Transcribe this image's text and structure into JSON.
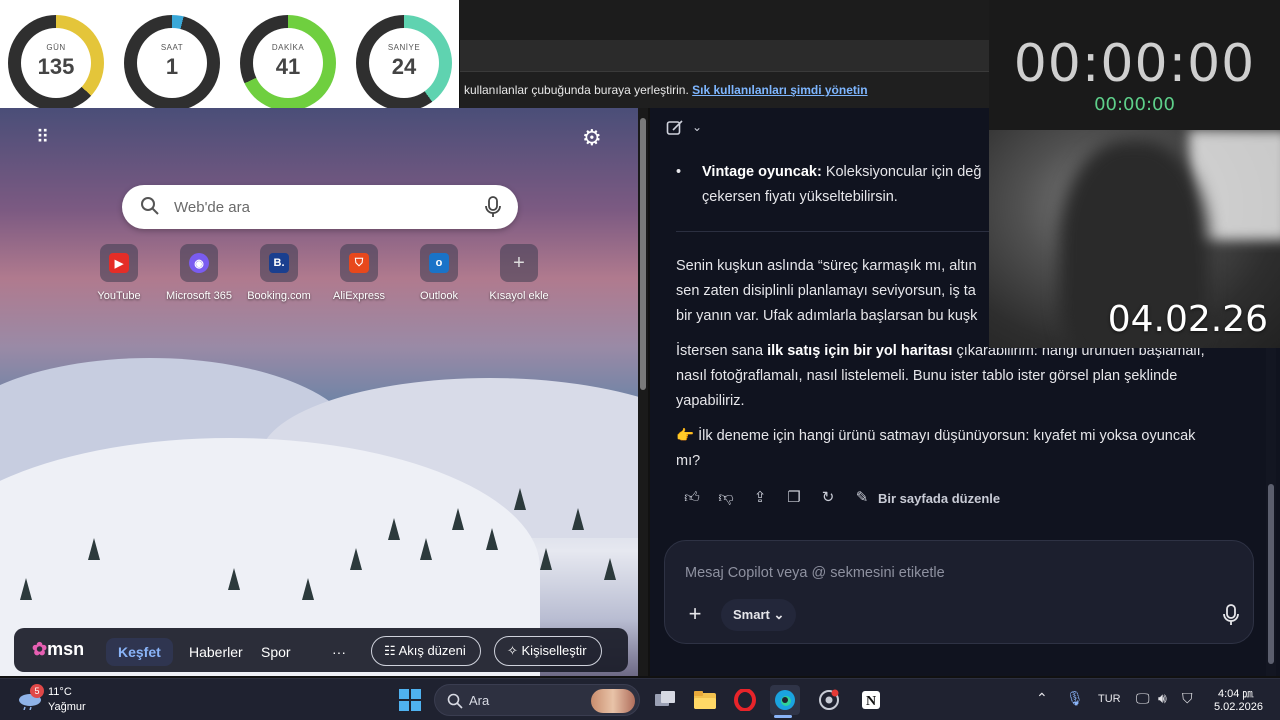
{
  "countdown": {
    "units": [
      {
        "label": "GÜN",
        "value": "135",
        "progress": 0.37,
        "color": "#e4c53a"
      },
      {
        "label": "SAAT",
        "value": "1",
        "progress": 0.04,
        "color": "#3aa8d8"
      },
      {
        "label": "DAKİKA",
        "value": "41",
        "progress": 0.68,
        "color": "#6fcf3f"
      },
      {
        "label": "SANİYE",
        "value": "24",
        "progress": 0.4,
        "color": "#5fd3b0"
      }
    ]
  },
  "stopwatch": {
    "main": "00:00:00",
    "sub": "00:00:00"
  },
  "webcam": {
    "date_overlay": "04.02.26"
  },
  "favorites_bar": {
    "text": "kullanılanlar çubuğunda buraya yerleştirin.",
    "link": "Sık kullanılanları şimdi yönetin"
  },
  "new_tab": {
    "search_placeholder": "Web'de ara",
    "quick_links": [
      {
        "label": "YouTube",
        "icon": "youtube-icon",
        "color": "#e52d27",
        "glyph": "▶"
      },
      {
        "label": "Microsoft 365",
        "icon": "microsoft-365-icon",
        "color": "#7a5cf0",
        "glyph": "◉"
      },
      {
        "label": "Booking.com",
        "icon": "booking-icon",
        "color": "#1a3f8f",
        "glyph": "B."
      },
      {
        "label": "AliExpress",
        "icon": "aliexpress-icon",
        "color": "#e8481c",
        "glyph": "⛉"
      },
      {
        "label": "Outlook",
        "icon": "outlook-icon",
        "color": "#1a73c8",
        "glyph": "o"
      },
      {
        "label": "Kısayol ekle",
        "icon": "add-shortcut-icon",
        "color": "transparent",
        "glyph": "+"
      }
    ],
    "msn": {
      "logo": "msn",
      "tabs": [
        "Keşfet",
        "Haberler",
        "Spor"
      ],
      "more": "···",
      "feed_layout": "Akış düzeni",
      "personalize": "Kişiselleştir"
    }
  },
  "copilot": {
    "bullet_label": "Vintage oyuncak:",
    "bullet_text": " Koleksiyoncular için değ",
    "bullet_text_2": "çekersen fiyatı yükseltebilirsin.",
    "para1_line1": "Senin kuşkun aslında “süreç karmaşık mı, altın",
    "para1_line2": "sen zaten disiplinli planlamayı seviyorsun, iş ta",
    "para1_line3": "bir yanın var. Ufak adımlarla başlarsan bu kuşk",
    "para2_prefix": "İstersen sana ",
    "para2_bold": "ilk satış için bir yol haritası",
    "para2_line1_rest": " çıkarabilirim: hangi üründen başlamalı,",
    "para2_line2": "nasıl fotoğraflamalı, nasıl listelemeli. Bunu ister tablo ister görsel plan şeklinde",
    "para2_line3": "yapabiliriz.",
    "para3_emoji": "👉",
    "para3_line1": " İlk deneme için hangi ürünü satmayı düşünüyorsun: kıyafet mi yoksa oyuncak",
    "para3_line2": "mı?",
    "edit_label": "Bir sayfada düzenle",
    "input_placeholder": "Mesaj Copilot veya @ sekmesini etiketle",
    "mode_label": "Smart"
  },
  "taskbar": {
    "weather": {
      "badge": "5",
      "temp": "11°C",
      "condition": "Yağmur"
    },
    "search_label": "Ara",
    "language": "TUR",
    "time": "4:04 ㏘",
    "date": "5.02.2026"
  }
}
